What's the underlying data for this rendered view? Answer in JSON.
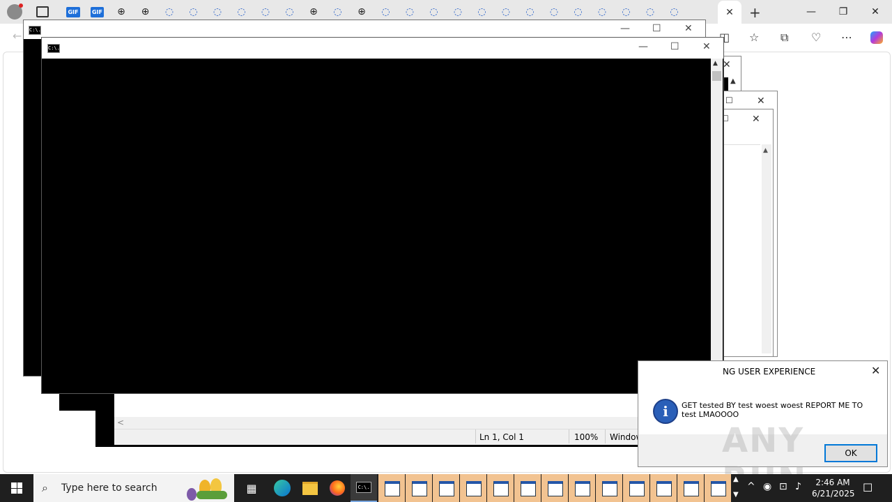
{
  "browser": {
    "tabs": [
      "gif",
      "gif",
      "globe",
      "globe",
      "loading",
      "loading",
      "loading",
      "loading",
      "loading",
      "loading",
      "globe",
      "loading",
      "globe",
      "loading",
      "loading",
      "loading",
      "loading",
      "loading",
      "loading",
      "loading",
      "loading",
      "loading",
      "loading",
      "loading",
      "loading",
      "loading"
    ],
    "active_tab_close": "✕",
    "new_tab": "+",
    "window_controls": {
      "minimize": "—",
      "restore": "❐",
      "close": "✕"
    },
    "toolbar_icons": [
      "split-screen-icon",
      "favorite-icon",
      "collections-icon",
      "browser-essentials-icon",
      "more-icon",
      "copilot-icon"
    ]
  },
  "console_back": {
    "icon_text": "C:\\.",
    "minimize": "—",
    "maximize": "☐",
    "close": "✕"
  },
  "console_front": {
    "icon_text": "C:\\.",
    "minimize": "—",
    "maximize": "☐",
    "close": "✕",
    "scroll_up": "▲",
    "scroll_down": "▼"
  },
  "notepad": {
    "position": "Ln 1, Col 1",
    "zoom": "100%",
    "line_ending": "Window",
    "scroll_left": "<"
  },
  "message_box": {
    "title": "NG USER EXPERIENCE",
    "close": "✕",
    "icon": "i",
    "text": "GET tested BY test woest woest REPORT ME TO test LMAOOOO",
    "ok": "OK"
  },
  "watermark": "ANY RUN",
  "taskbar": {
    "search_placeholder": "Type here to search",
    "window_buttons": 13,
    "time": "2:46 AM",
    "date": "6/21/2025"
  },
  "colors": {
    "accent": "#0078d7",
    "taskbar": "#1f1f1f",
    "task_button": "#f2c391",
    "info_icon": "#2a5fb8"
  }
}
